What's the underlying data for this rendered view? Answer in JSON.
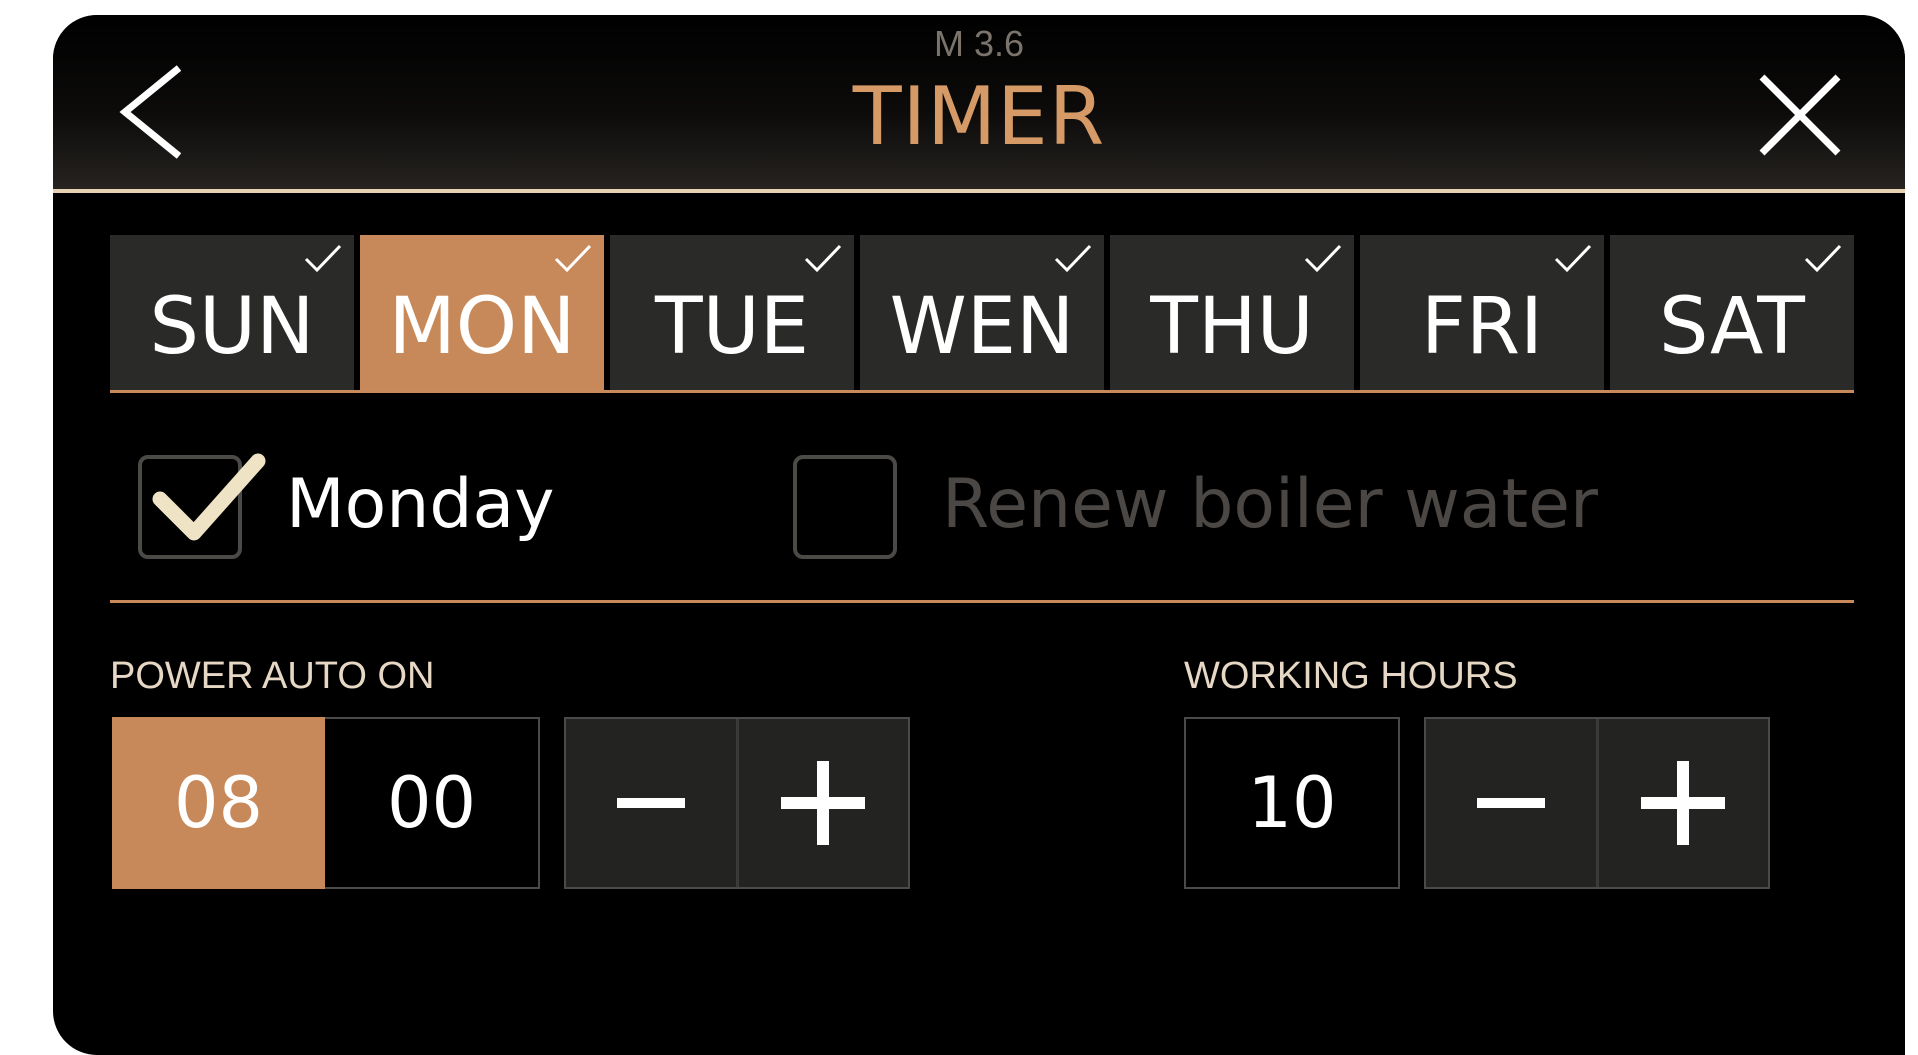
{
  "header": {
    "version": "M 3.6",
    "title": "TIMER",
    "back_icon": "chevron-left-icon",
    "close_icon": "close-icon"
  },
  "days": [
    {
      "label": "SUN",
      "checked": true,
      "selected": false
    },
    {
      "label": "MON",
      "checked": true,
      "selected": true
    },
    {
      "label": "TUE",
      "checked": true,
      "selected": false
    },
    {
      "label": "WEN",
      "checked": true,
      "selected": false
    },
    {
      "label": "THU",
      "checked": true,
      "selected": false
    },
    {
      "label": "FRI",
      "checked": true,
      "selected": false
    },
    {
      "label": "SAT",
      "checked": true,
      "selected": false
    }
  ],
  "options": {
    "day_enabled": {
      "label": "Monday",
      "checked": true
    },
    "renew_boiler_water": {
      "label": "Renew boiler water",
      "checked": false
    }
  },
  "power_auto_on": {
    "label": "POWER AUTO ON",
    "hour": "08",
    "minute": "00",
    "decrement_icon": "minus-icon",
    "increment_icon": "plus-icon"
  },
  "working_hours": {
    "label": "WORKING HOURS",
    "value": "10",
    "decrement_icon": "minus-icon",
    "increment_icon": "plus-icon"
  },
  "colors": {
    "accent": "#c8895a",
    "title": "#d69a66",
    "background": "#000000",
    "button": "#2a2a28",
    "disabled_text": "#4a4744"
  }
}
